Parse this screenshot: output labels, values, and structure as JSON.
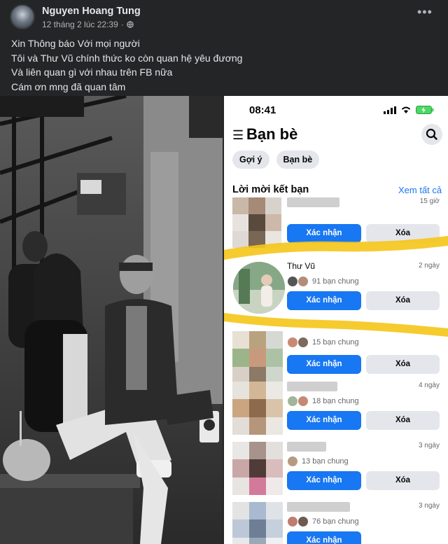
{
  "post": {
    "author": "Nguyen Hoang Tung",
    "timestamp": "12 tháng 2 lúc 22:39",
    "privacy_icon": "globe-icon",
    "more_icon": "more-icon",
    "caption_lines": [
      "Xin Thông báo Với mọi người",
      "Tôi và Thư Vũ chính thức ko còn quan hệ yêu đương",
      "Và  liên quan gì với nhau trên FB nữa",
      "Cám ơn mng đã quan tâm"
    ]
  },
  "screenshot": {
    "time": "08:41",
    "page_title": "Bạn bè",
    "chips": [
      "Gợi ý",
      "Bạn bè"
    ],
    "section_title": "Lời mời kết bạn",
    "see_all": "Xem tất cả",
    "confirm_label": "Xác nhận",
    "delete_label": "Xóa",
    "requests": [
      {
        "name": "",
        "time": "15 giờ",
        "mutual": ""
      },
      {
        "name": "Thư Vũ",
        "time": "2 ngày",
        "mutual": "91 bạn chung"
      },
      {
        "name": "",
        "time": "",
        "mutual": "15 bạn chung"
      },
      {
        "name": "",
        "time": "4 ngày",
        "mutual": "18 bạn chung"
      },
      {
        "name": "",
        "time": "3 ngày",
        "mutual": "13 bạn chung"
      },
      {
        "name": "",
        "time": "3 ngày",
        "mutual": "76 bạn chung"
      }
    ]
  },
  "colors": {
    "facebook_blue": "#1877f2",
    "post_bg": "#242526",
    "highlight_yellow": "#f5c518"
  }
}
